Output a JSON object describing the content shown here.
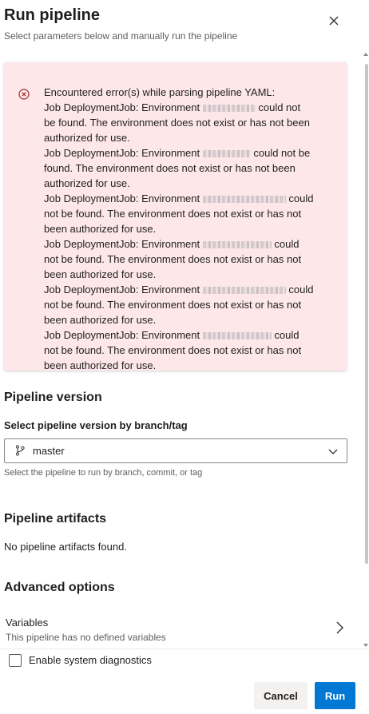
{
  "header": {
    "title": "Run pipeline",
    "subtitle": "Select parameters below and manually run the pipeline"
  },
  "error": {
    "heading": "Encountered error(s) while parsing pipeline YAML:",
    "prefix": "Job DeploymentJob: Environment",
    "suffix_a": "could not be found. The environment does not exist or has not been authorized for use.",
    "messages": [
      {
        "line1_end": "could not",
        "line2": "be found. The environment does not exist or has not been",
        "line3": "authorized for use."
      },
      {
        "line1_end": "could not be",
        "line2": "found. The environment does not exist or has not been",
        "line3": "authorized for use."
      },
      {
        "line1_end": "could",
        "line2": "not be found. The environment does not exist or has not",
        "line3": "been authorized for use."
      },
      {
        "line1_end": "could",
        "line2": "not be found. The environment does not exist or has not",
        "line3": "been authorized for use."
      },
      {
        "line1_end": "could",
        "line2": "not be found. The environment does not exist or has not",
        "line3": "been authorized for use."
      },
      {
        "line1_end": "could",
        "line2": "not be found. The environment does not exist or has not",
        "line3": "been authorized for use."
      }
    ]
  },
  "pipeline_version": {
    "heading": "Pipeline version",
    "field_label": "Select pipeline version by branch/tag",
    "selected": "master",
    "helper": "Select the pipeline to run by branch, commit, or tag"
  },
  "artifacts": {
    "heading": "Pipeline artifacts",
    "empty_text": "No pipeline artifacts found."
  },
  "advanced": {
    "heading": "Advanced options",
    "variables_label": "Variables",
    "variables_desc": "This pipeline has no defined variables"
  },
  "footer": {
    "diagnostics_label": "Enable system diagnostics",
    "cancel_label": "Cancel",
    "run_label": "Run"
  },
  "colors": {
    "error_bg": "#fde7e9",
    "error_icon": "#a4262c",
    "primary": "#0078d4"
  }
}
